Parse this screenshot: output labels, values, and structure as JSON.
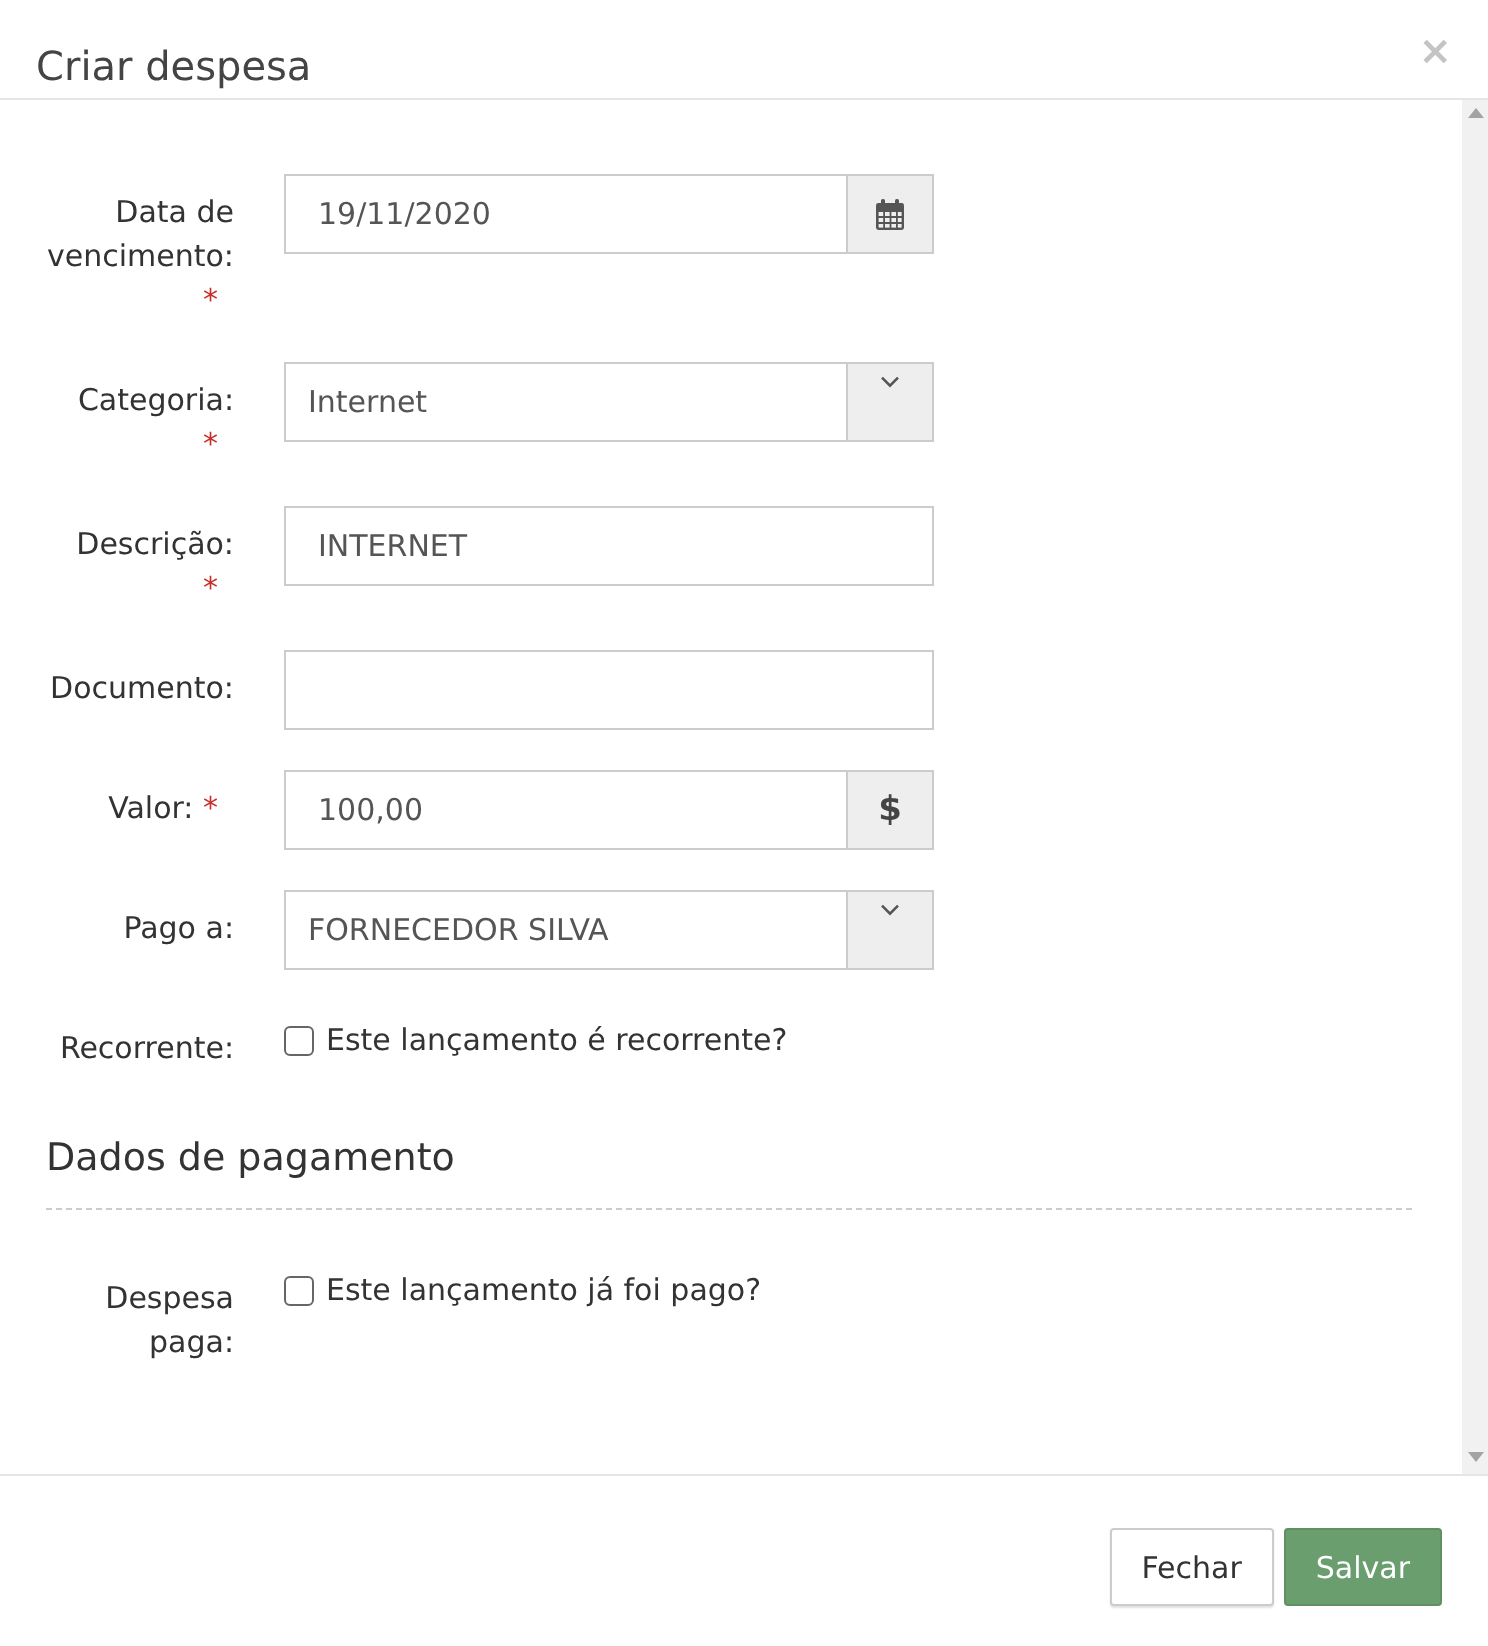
{
  "modal": {
    "title": "Criar despesa",
    "close": "×"
  },
  "fields": [
    {
      "kind": "date",
      "label": "Data de vencimento:",
      "required_mark": "*",
      "value": "19/11/2020"
    },
    {
      "kind": "select",
      "label": "Categoria:",
      "required_mark": "*",
      "value": "Internet"
    },
    {
      "kind": "text",
      "label": "Descrição:",
      "required_mark": "*",
      "value": "INTERNET"
    },
    {
      "kind": "text",
      "label": "Documento:"
    },
    {
      "kind": "addon",
      "label": "Valor:",
      "required_mark": "*",
      "value": "100,00",
      "addon": "$"
    },
    {
      "kind": "select",
      "label": "Pago a:",
      "value": "FORNECEDOR SILVA"
    },
    {
      "kind": "checkbox",
      "label": "Recorrente:",
      "checked": false,
      "text": "Este lançamento é recorrente?"
    }
  ],
  "payment_section": {
    "title": "Dados de pagamento",
    "fields": [
      {
        "kind": "checkbox",
        "label": "Despesa paga:",
        "checked": false,
        "text": "Este lançamento já foi pago?"
      }
    ]
  },
  "buttons": [
    {
      "kind": "default",
      "label": "Fechar"
    },
    {
      "kind": "primary",
      "label": "Salvar"
    }
  ]
}
